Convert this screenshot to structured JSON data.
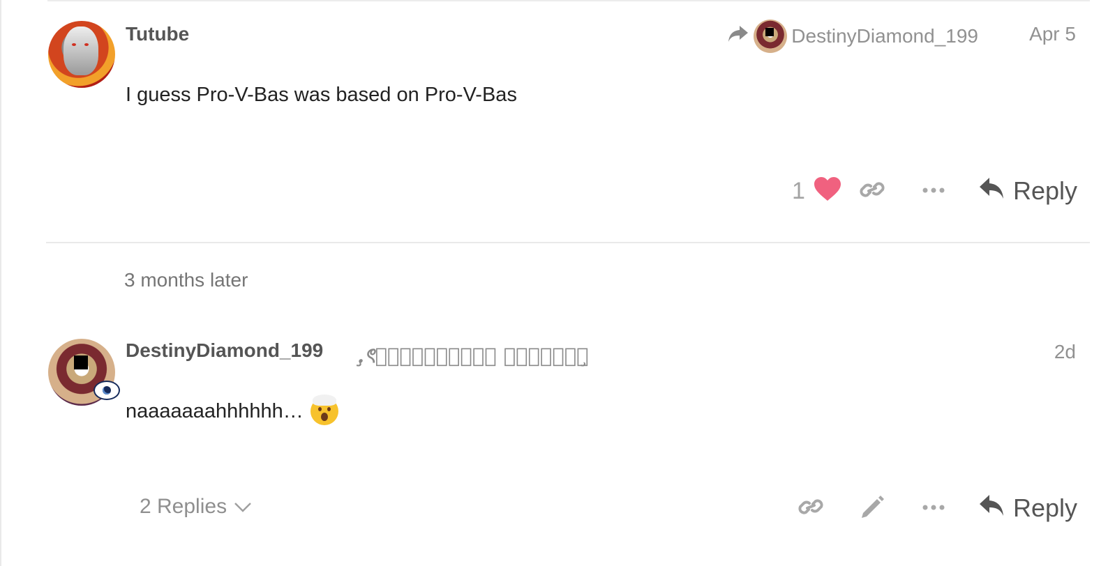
{
  "post1": {
    "username": "Tutube",
    "reply_to_username": "DestinyDiamond_199",
    "date": "Apr 5",
    "body": "I guess Pro-V-Bas was based on Pro-V-Bas",
    "like_count": "1",
    "reply_label": "Reply"
  },
  "time_gap": "3 months later",
  "post2": {
    "username": "DestinyDiamond_199",
    "flair": ".̧ৎ✝☬⌖𝓔𝔁𝓪𝓵𝓽𝓮𝓭 𝓞𝓷𝓮⌖☬✝ৎ̧",
    "date": "2d",
    "body": "naaaaaaahhhhhh…",
    "replies_label": "2 Replies",
    "reply_label": "Reply"
  },
  "colors": {
    "heart": "#f0617f",
    "muted_text": "#919191",
    "divider": "#e9e9e9"
  },
  "icons": [
    "share-arrow-icon",
    "heart-icon",
    "link-icon",
    "more-icon",
    "reply-icon",
    "pencil-icon",
    "chevron-down-icon"
  ]
}
